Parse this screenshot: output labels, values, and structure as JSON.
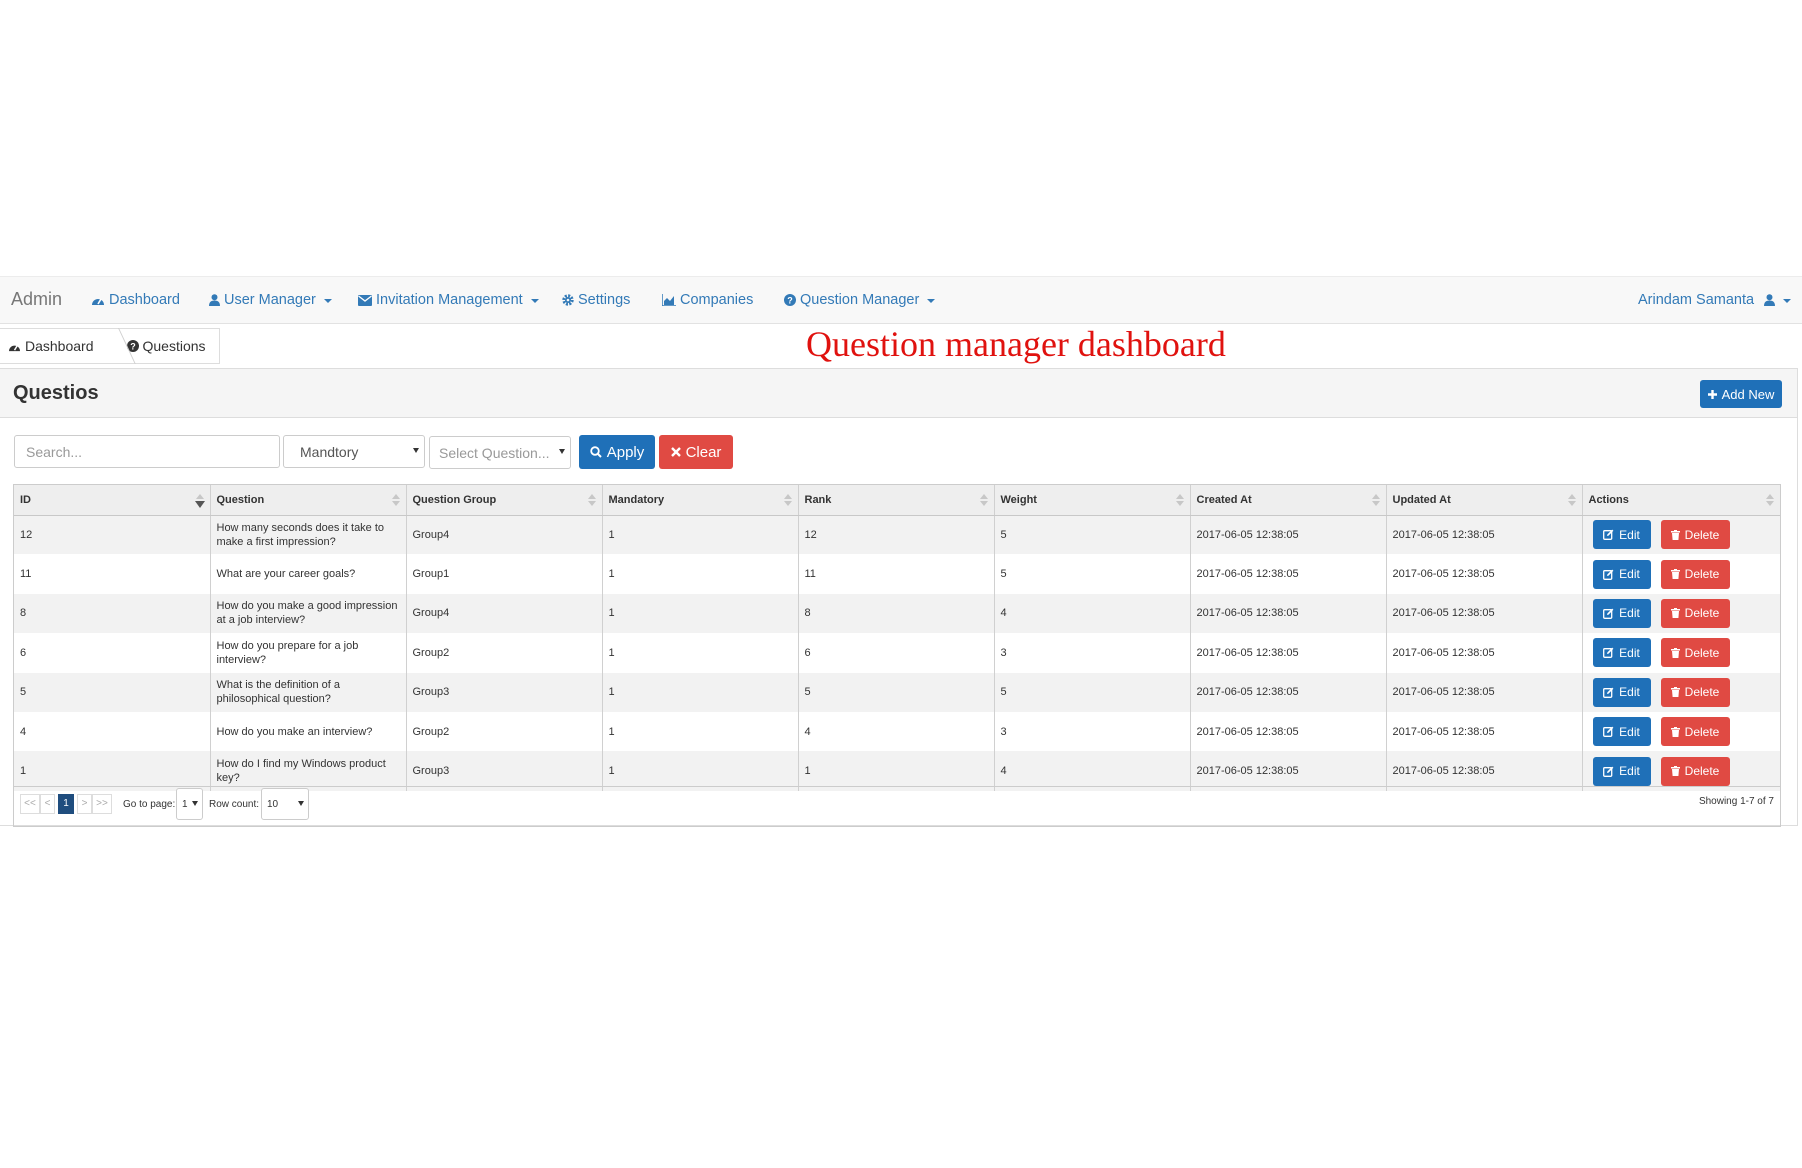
{
  "navbar": {
    "brand": "Admin",
    "items": [
      {
        "label": "Dashboard",
        "icon": "dashboard-icon"
      },
      {
        "label": "User Manager",
        "icon": "user-icon",
        "dropdown": true
      },
      {
        "label": "Invitation Management",
        "icon": "envelope-icon",
        "dropdown": true
      },
      {
        "label": "Settings",
        "icon": "gear-icon"
      },
      {
        "label": "Companies",
        "icon": "area-chart-icon"
      },
      {
        "label": "Question Manager",
        "icon": "question-circle-icon",
        "dropdown": true
      }
    ],
    "user": {
      "label": "Arindam Samanta",
      "icon": "user-icon"
    }
  },
  "breadcrumb": {
    "dashboard": "Dashboard",
    "questions": "Questions"
  },
  "annotation": "Question manager dashboard",
  "panel": {
    "title": "Questios",
    "add_label": "Add New"
  },
  "filters": {
    "search_placeholder": "Search...",
    "mandatory_value": "Mandtory",
    "question_placeholder": "Select Question...",
    "apply_label": "Apply",
    "clear_label": "Clear"
  },
  "table": {
    "columns": [
      "ID",
      "Question",
      "Question Group",
      "Mandatory",
      "Rank",
      "Weight",
      "Created At",
      "Updated At",
      "Actions"
    ],
    "rows": [
      {
        "id": "12",
        "question": "How many seconds does it take to make a first impression?",
        "group": "Group4",
        "mandatory": "1",
        "rank": "12",
        "weight": "5",
        "created": "2017-06-05 12:38:05",
        "updated": "2017-06-05 12:38:05"
      },
      {
        "id": "11",
        "question": "What are your career goals?",
        "group": "Group1",
        "mandatory": "1",
        "rank": "11",
        "weight": "5",
        "created": "2017-06-05 12:38:05",
        "updated": "2017-06-05 12:38:05"
      },
      {
        "id": "8",
        "question": "How do you make a good impression at a job interview?",
        "group": "Group4",
        "mandatory": "1",
        "rank": "8",
        "weight": "4",
        "created": "2017-06-05 12:38:05",
        "updated": "2017-06-05 12:38:05"
      },
      {
        "id": "6",
        "question": "How do you prepare for a job interview?",
        "group": "Group2",
        "mandatory": "1",
        "rank": "6",
        "weight": "3",
        "created": "2017-06-05 12:38:05",
        "updated": "2017-06-05 12:38:05"
      },
      {
        "id": "5",
        "question": "What is the definition of a philosophical question?",
        "group": "Group3",
        "mandatory": "1",
        "rank": "5",
        "weight": "5",
        "created": "2017-06-05 12:38:05",
        "updated": "2017-06-05 12:38:05"
      },
      {
        "id": "4",
        "question": "How do you make an interview?",
        "group": "Group2",
        "mandatory": "1",
        "rank": "4",
        "weight": "3",
        "created": "2017-06-05 12:38:05",
        "updated": "2017-06-05 12:38:05"
      },
      {
        "id": "1",
        "question": "How do I find my Windows product key?",
        "group": "Group3",
        "mandatory": "1",
        "rank": "1",
        "weight": "4",
        "created": "2017-06-05 12:38:05",
        "updated": "2017-06-05 12:38:05"
      }
    ],
    "edit_label": "Edit",
    "delete_label": "Delete"
  },
  "pager": {
    "first": "<<",
    "prev": "<",
    "current": "1",
    "next": ">",
    "last": ">>",
    "goto_label": "Go to page:",
    "goto_value": "1",
    "rowcount_label": "Row count:",
    "rowcount_value": "10",
    "showing": "Showing 1-7 of 7"
  },
  "colors": {
    "primary": "#1f70b8",
    "danger": "#e04a43",
    "link": "#337ab7",
    "annotation": "#e0120f"
  }
}
